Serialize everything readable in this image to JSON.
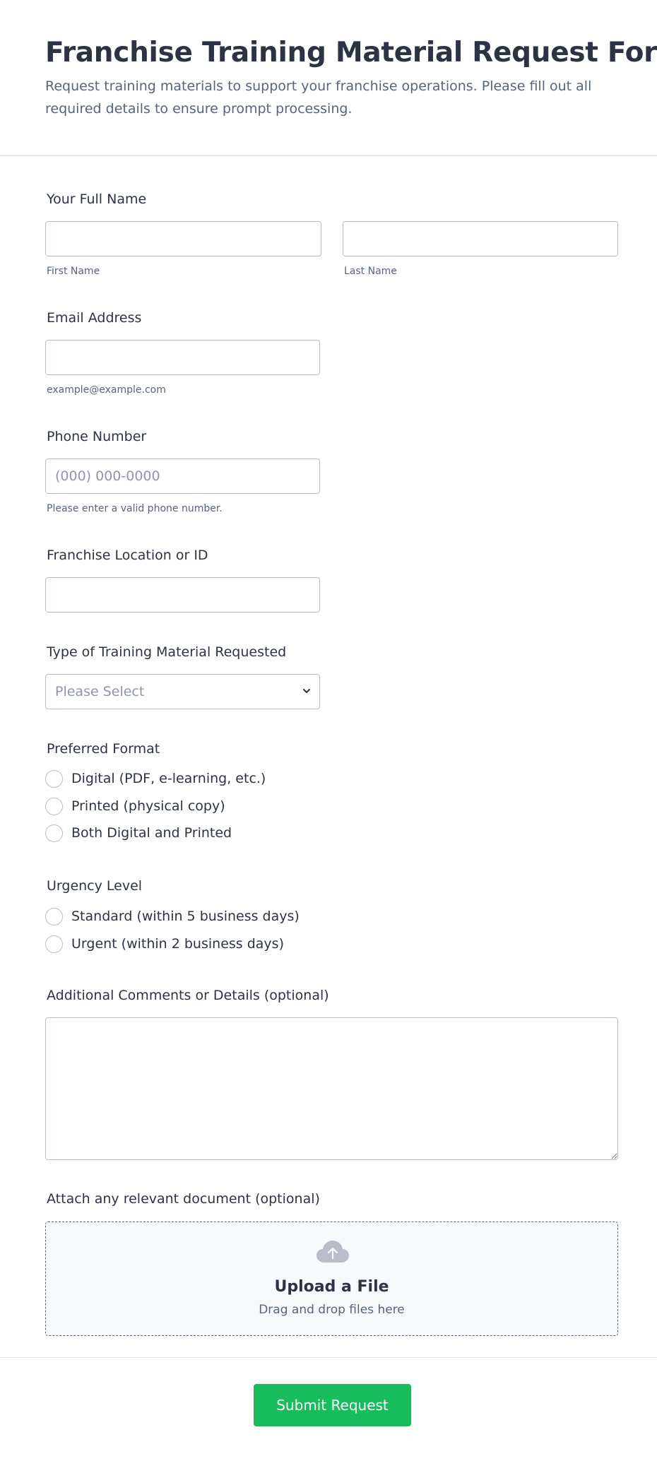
{
  "header": {
    "title": "Franchise Training Material Request Form",
    "subtitle": "Request training materials to support your franchise operations. Please fill out all required details to ensure prompt processing."
  },
  "fields": {
    "full_name": {
      "label": "Your Full Name",
      "first_sublabel": "First Name",
      "last_sublabel": "Last Name",
      "first_value": "",
      "last_value": ""
    },
    "email": {
      "label": "Email Address",
      "sublabel": "example@example.com",
      "value": ""
    },
    "phone": {
      "label": "Phone Number",
      "placeholder": "(000) 000-0000",
      "sublabel": "Please enter a valid phone number.",
      "value": ""
    },
    "location": {
      "label": "Franchise Location or ID",
      "value": ""
    },
    "material_type": {
      "label": "Type of Training Material Requested",
      "selected": "Please Select"
    },
    "preferred_format": {
      "label": "Preferred Format",
      "options": [
        "Digital (PDF, e-learning, etc.)",
        "Printed (physical copy)",
        "Both Digital and Printed"
      ]
    },
    "urgency": {
      "label": "Urgency Level",
      "options": [
        "Standard (within 5 business days)",
        "Urgent (within 2 business days)"
      ]
    },
    "comments": {
      "label": "Additional Comments or Details (optional)",
      "value": ""
    },
    "attachment": {
      "label": "Attach any relevant document (optional)",
      "title": "Upload a File",
      "subtitle": "Drag and drop files here"
    }
  },
  "submit_label": "Submit Request",
  "colors": {
    "accent": "#18bd5b",
    "text": "#2c3345",
    "muted": "#57647e",
    "border": "#b8bdc9"
  },
  "icons": {
    "select": "chevron-down-icon",
    "upload": "cloud-upload-icon"
  }
}
